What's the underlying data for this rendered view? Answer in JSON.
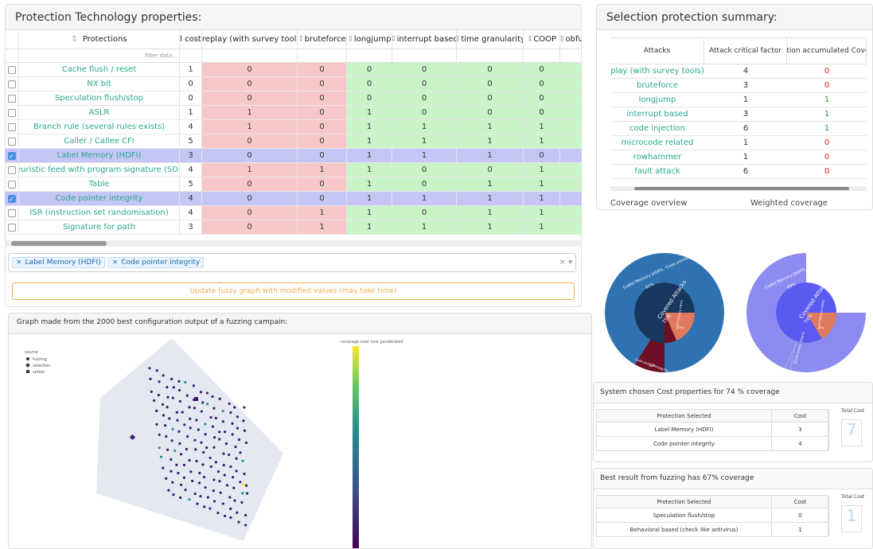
{
  "protection_panel": {
    "title": "Protection Technology properties:"
  },
  "protection_table": {
    "headers": [
      "",
      "Protections",
      "l cost",
      "replay (with survey tools)",
      "bruteforce",
      "longjump",
      "interrupt based",
      "time granularity",
      "COOP",
      "obfu"
    ],
    "filter_placeholder": "filter data...",
    "rows": [
      {
        "checked": false,
        "name": "Cache flush / reset",
        "cost": "1",
        "vals": [
          "0",
          "0",
          "0",
          "0",
          "0",
          "0"
        ]
      },
      {
        "checked": false,
        "name": "NX bit",
        "cost": "0",
        "vals": [
          "0",
          "0",
          "0",
          "0",
          "0",
          "0"
        ]
      },
      {
        "checked": false,
        "name": "Speculation flush/stop",
        "cost": "0",
        "vals": [
          "0",
          "0",
          "0",
          "0",
          "0",
          "0"
        ]
      },
      {
        "checked": false,
        "name": "ASLR",
        "cost": "1",
        "vals": [
          "1",
          "0",
          "1",
          "0",
          "0",
          "0"
        ]
      },
      {
        "checked": false,
        "name": "Branch rule (several rules exists)",
        "cost": "4",
        "vals": [
          "1",
          "0",
          "1",
          "1",
          "1",
          "1"
        ]
      },
      {
        "checked": false,
        "name": "Caller / Callee CFI",
        "cost": "5",
        "vals": [
          "0",
          "0",
          "1",
          "1",
          "1",
          "1"
        ]
      },
      {
        "checked": true,
        "name": "Label Memory (HDFI)",
        "cost": "3",
        "vals": [
          "0",
          "0",
          "1",
          "1",
          "1",
          "0"
        ]
      },
      {
        "checked": false,
        "name": "Heuristic feed with program signature (SOM)",
        "cost": "4",
        "vals": [
          "1",
          "1",
          "1",
          "0",
          "0",
          "1"
        ]
      },
      {
        "checked": false,
        "name": "Table",
        "cost": "5",
        "vals": [
          "0",
          "0",
          "1",
          "0",
          "1",
          "1"
        ]
      },
      {
        "checked": true,
        "name": "Code pointer integrity",
        "cost": "4",
        "vals": [
          "0",
          "0",
          "1",
          "1",
          "1",
          "1"
        ]
      },
      {
        "checked": false,
        "name": "ISR (instruction set randomisation)",
        "cost": "4",
        "vals": [
          "0",
          "1",
          "1",
          "0",
          "1",
          "1"
        ]
      },
      {
        "checked": false,
        "name": "Signature for path",
        "cost": "3",
        "vals": [
          "0",
          "1",
          "1",
          "1",
          "1",
          "1"
        ]
      }
    ],
    "col_colors": [
      "red",
      "red",
      "green",
      "green",
      "green",
      "green"
    ]
  },
  "selection": {
    "tags": [
      "Label Memory (HDFI)",
      "Code pointer integrity"
    ],
    "clear": "×",
    "caret": "▾"
  },
  "update_button": "Update fuzzy graph with modified values (may take time)",
  "summary_panel": {
    "title": "Selection protection summary:",
    "headers": [
      "Attacks",
      "Attack critical factor",
      "Selection accumulated Coverage"
    ],
    "rows": [
      {
        "attack": "play (with survey tools)",
        "factor": "4",
        "cov": "0",
        "ok": false
      },
      {
        "attack": "bruteforce",
        "factor": "3",
        "cov": "0",
        "ok": false
      },
      {
        "attack": "longjump",
        "factor": "1",
        "cov": "1",
        "ok": true
      },
      {
        "attack": "interrupt based",
        "factor": "3",
        "cov": "1",
        "ok": true
      },
      {
        "attack": "code injection",
        "factor": "6",
        "cov": "1",
        "ok": true
      },
      {
        "attack": "microcode related",
        "factor": "1",
        "cov": "0",
        "ok": false
      },
      {
        "attack": "rowhammer",
        "factor": "1",
        "cov": "0",
        "ok": false
      },
      {
        "attack": "fault attack",
        "factor": "6",
        "cov": "0",
        "ok": false
      }
    ]
  },
  "sunburst": {
    "overview": {
      "label": "Coverage overview",
      "center": "Covered Attacks",
      "center_pct": "75%",
      "outer_label": "[Label Memory (HDFI), 'Code pointer integrity']",
      "outer_pct": "65%",
      "slice1": "Code pointer integrity",
      "slice1_pct": "13%",
      "slice2": "Label Memory (HDFI)",
      "slice2_pct": "10%"
    },
    "weighted": {
      "label": "Weighted coverage",
      "center": "Covered Attacks",
      "center_pct": "74%",
      "outer_label": "[Label Memory (HDFI), 'Code pointer integrity']",
      "outer_pct": "69%",
      "slice1": "Code pointer integrity",
      "slice1_pct": "7%",
      "slice2": "Label Memory (HDFI)",
      "slice2_pct": "6%"
    },
    "colors": {
      "dark_blue": "#17375e",
      "mid_blue": "#2f72b2",
      "salmon": "#e07a5f",
      "maroon": "#6d0f24",
      "lav": "#8c8cf0",
      "violet": "#5a5af0"
    }
  },
  "graph": {
    "title": "Graph made from the 2000 best configuration output of a fuzzing campain:",
    "legend_title": "source",
    "legend": [
      "fuzzing",
      "selection",
      "sofeer"
    ],
    "colorbar_title": "coverage over cost ponderated"
  },
  "cost_panel": {
    "title": "System chosen Cost properties for 74 % coverage",
    "headers": [
      "Protection Selected",
      "Cost"
    ],
    "rows": [
      {
        "name": "Label Memory (HDFI)",
        "cost": "3"
      },
      {
        "name": "Code pointer integrity",
        "cost": "4"
      }
    ],
    "total_label": "Total Cost",
    "total_value": "7"
  },
  "best_panel": {
    "title": "Best result from fuzzing has 67% coverage",
    "headers": [
      "Protection Selected",
      "Cost"
    ],
    "rows": [
      {
        "name": "Speculation flush/stop",
        "cost": "0"
      },
      {
        "name": "Behavioral based (check like antivirus)",
        "cost": "1"
      }
    ],
    "total_label": "Total Cost",
    "total_value": "1"
  }
}
